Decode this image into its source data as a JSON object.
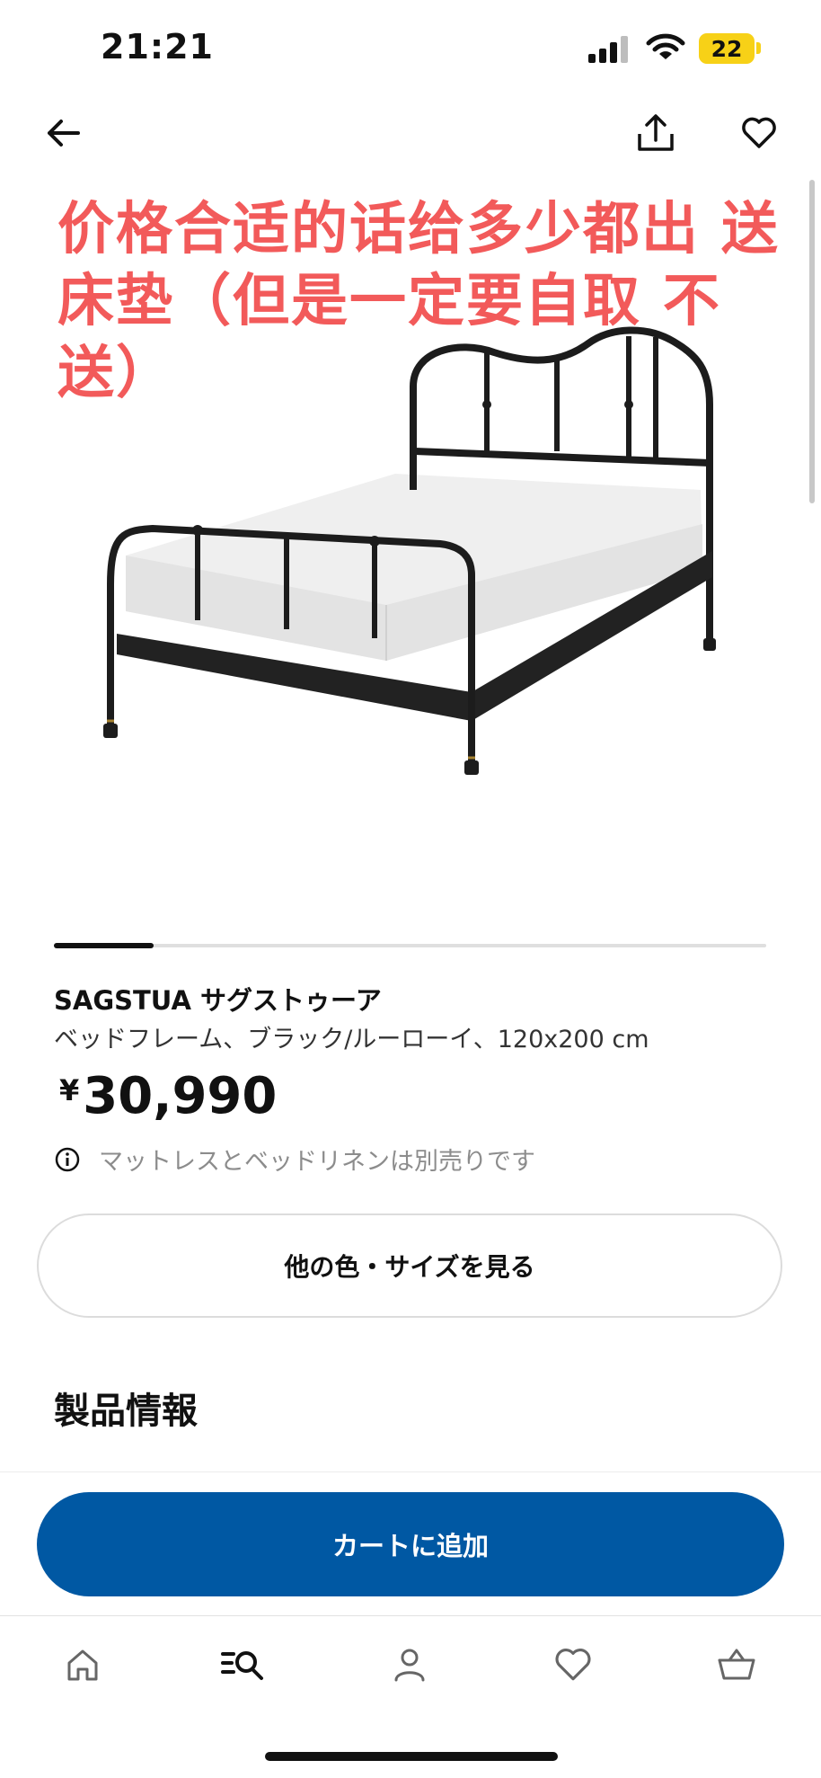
{
  "status_bar": {
    "time": "21:21",
    "battery": "22"
  },
  "header": {
    "back_icon": "arrow-left-icon",
    "share_icon": "share-icon",
    "favorite_icon": "heart-icon"
  },
  "overlay_text": "价格合适的话给多少都出 送床垫（但是一定要自取 不送）",
  "gallery": {
    "image": "metal-bed-frame-with-white-mattress",
    "progress": 0.14
  },
  "product": {
    "name": "SAGSTUA サグストゥーア",
    "description": "ベッドフレーム、ブラック/ルーローイ、120x200 cm",
    "currency": "¥",
    "price": "30,990",
    "note": "マットレスとベッドリネンは別売りです"
  },
  "variant_button": "他の色・サイズを見る",
  "section_title": "製品情報",
  "cart_button": "カートに追加",
  "tabs": [
    {
      "name": "home",
      "icon": "home-icon"
    },
    {
      "name": "search",
      "icon": "search-list-icon"
    },
    {
      "name": "profile",
      "icon": "user-icon"
    },
    {
      "name": "favorites",
      "icon": "heart-icon"
    },
    {
      "name": "cart",
      "icon": "basket-icon"
    }
  ],
  "colors": {
    "accent_blue": "#0058a3",
    "overlay_red": "#f25a5a",
    "battery_yellow": "#f7d117"
  }
}
